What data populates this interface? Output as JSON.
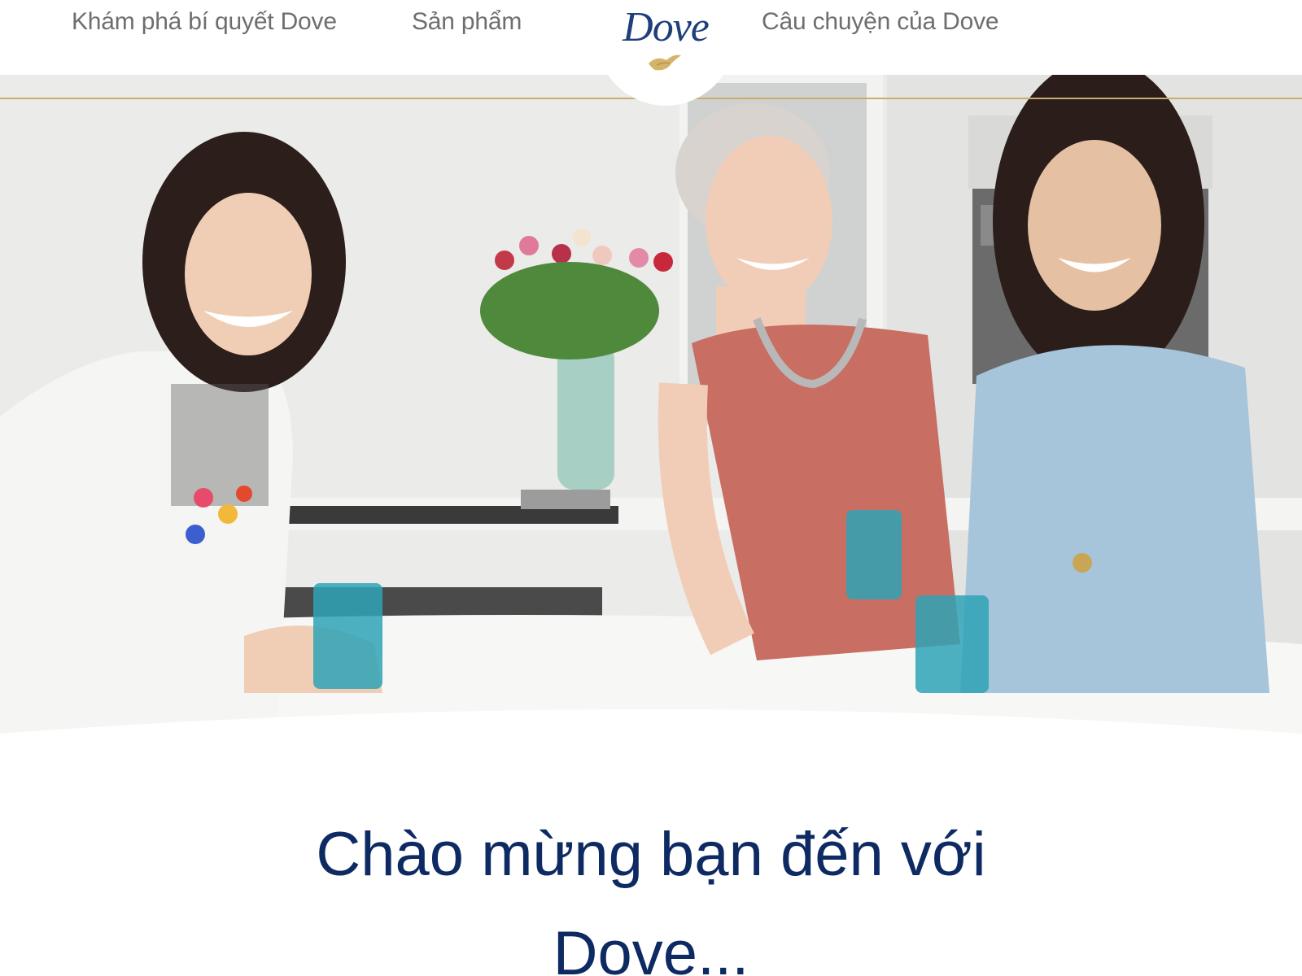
{
  "nav": {
    "discover_label": "Khám phá bí quyết Dove",
    "products_label": "Sản phẩm",
    "story_label": "Câu chuyện của Dove"
  },
  "logo": {
    "text": "Dove",
    "icon": "dove-bird-icon"
  },
  "hero": {
    "heading": "Chào mừng bạn đến với Dove..."
  },
  "colors": {
    "brand_navy": "#0e2a62",
    "logo_blue": "#1f3f7a",
    "gold_accent": "#c9ad6c",
    "nav_gray": "#6e6e6e"
  }
}
